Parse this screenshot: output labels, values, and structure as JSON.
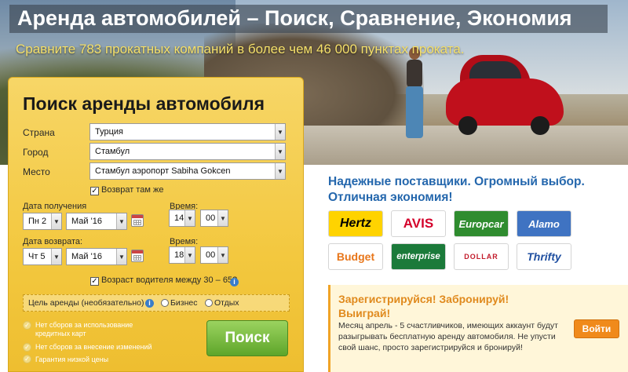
{
  "header": {
    "title": "Аренда автомобилей – Поиск, Сравнение, Экономия",
    "subtitle": "Сравните 783 прокатных компаний в более чем 46 000 пунктах проката."
  },
  "search": {
    "title": "Поиск аренды автомобиля",
    "country_label": "Страна",
    "country_value": "Турция",
    "city_label": "Город",
    "city_value": "Стамбул",
    "place_label": "Место",
    "place_value": "Стамбул аэропорт Sabiha Gokcen",
    "return_same_label": "Возврат там же",
    "pickup_date_label": "Дата получения",
    "pickup_day": "Пн 2",
    "pickup_month": "Май '16",
    "pickup_time_label": "Время:",
    "pickup_hour": "14",
    "pickup_minute": "00",
    "return_date_label": "Дата возврата:",
    "return_day": "Чт 5",
    "return_month": "Май '16",
    "return_time_label": "Время:",
    "return_hour": "18",
    "return_minute": "00",
    "driver_age_label": "Возраст водителя между 30 – 65?",
    "purpose_label": "Цель аренды (необязательно)",
    "purpose_options": [
      "Бизнес",
      "Отдых"
    ],
    "benefits": [
      "Нет сборов за использование кредитных карт",
      "Нет сборов за внесение изменений",
      "Гарантия низкой цены"
    ],
    "search_button": "Поиск"
  },
  "providers": {
    "heading": "Надежные поставщики. Огромный выбор. Отличная экономия!",
    "logos": [
      "Hertz",
      "AVIS",
      "Europcar",
      "Alamo",
      "Budget",
      "enterprise",
      "DOLLAR",
      "Thrifty"
    ]
  },
  "promo": {
    "title": "Зарегистрируйся! Забронируй! Выиграй!",
    "text": "Месяц апрель - 5 счастливчиков, имеющих аккаунт будут разыгрывать бесплатную аренду автомобиля. Не упусти свой шанс, просто зарегистрируйся и бронируй!",
    "login_button": "Войти"
  },
  "colors": {
    "accent_blue": "#2467ad",
    "panel_yellow": "#f3c83f",
    "search_green": "#5ea52a",
    "promo_orange": "#e08a1e",
    "subtitle_yellow": "#f5e06a"
  }
}
